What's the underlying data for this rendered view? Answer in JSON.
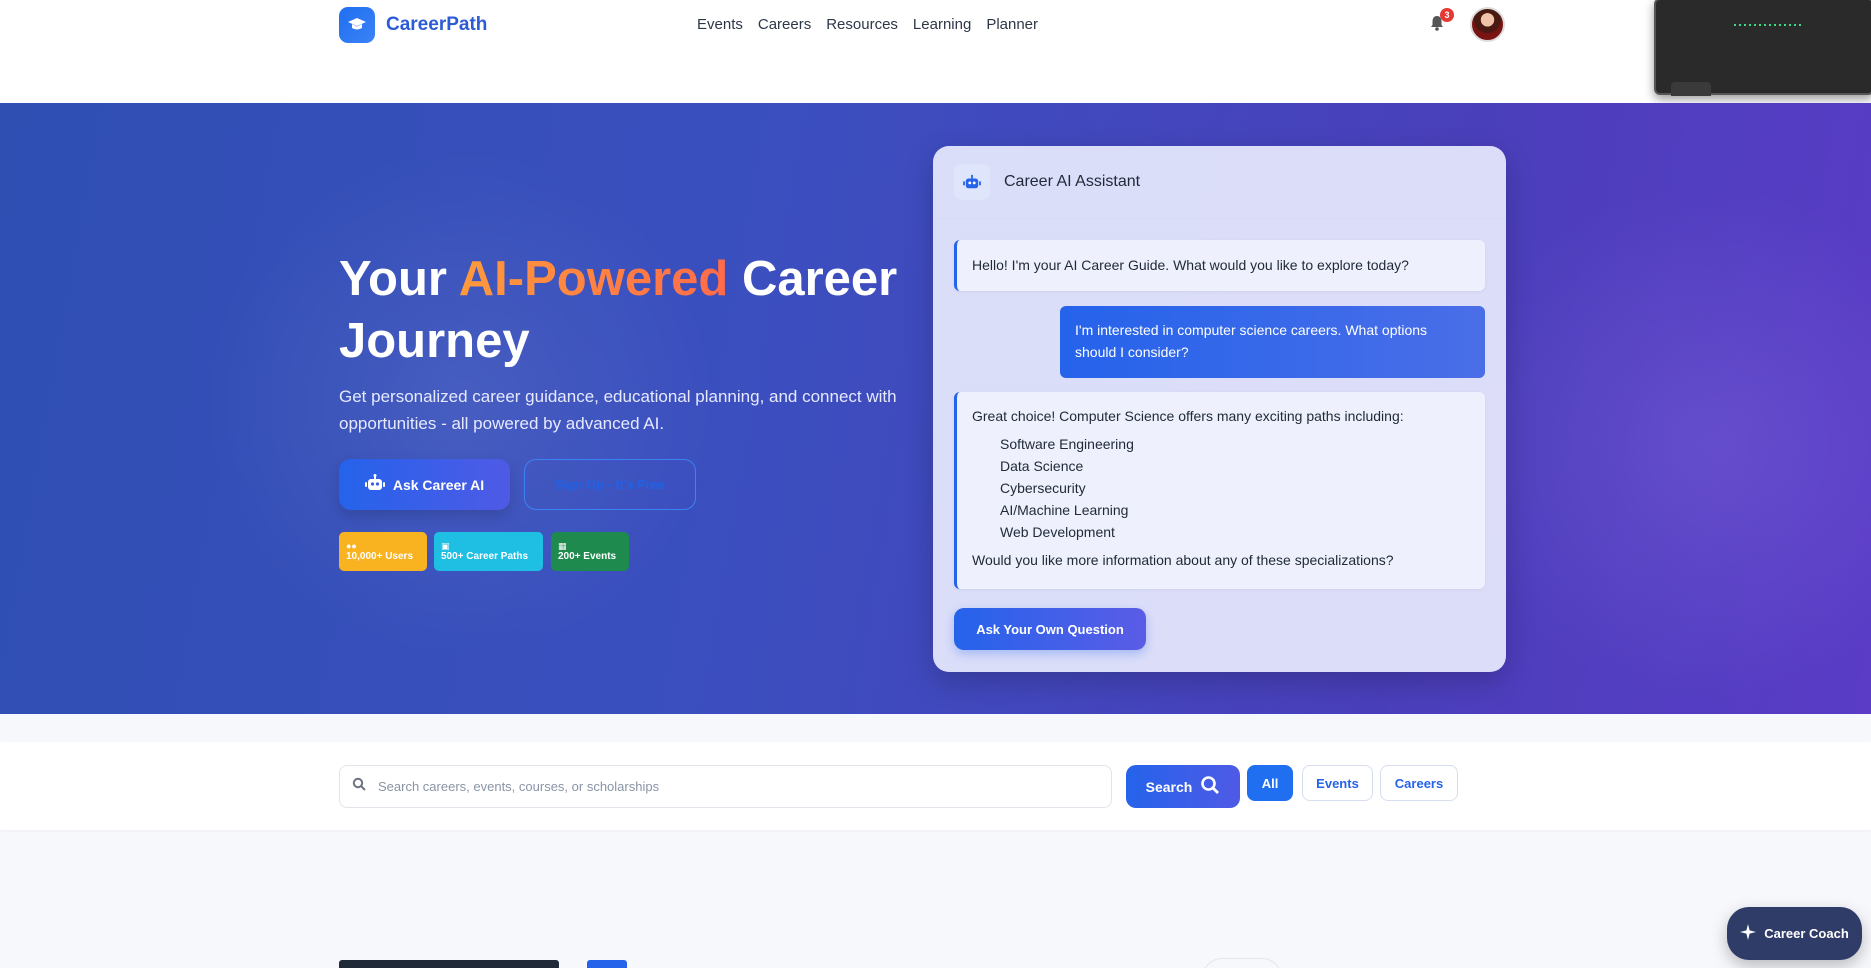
{
  "brand": {
    "name": "CareerPath",
    "icon": "graduation-cap-icon"
  },
  "nav": {
    "links": [
      "Events",
      "Careers",
      "Resources",
      "Learning",
      "Planner"
    ]
  },
  "notifications": {
    "count": "3",
    "icon": "bell-icon"
  },
  "hero": {
    "title_part1": "Your ",
    "title_accent": "AI-Powered",
    "title_part2": " Career Journey",
    "subtitle": "Get personalized career guidance, educational planning, and connect with opportunities - all powered by advanced AI.",
    "ask_button": "Ask Career AI",
    "signup_button": "Sign Up - It's Free",
    "stats": [
      {
        "label": "10,000+ Users",
        "icon": "users-icon"
      },
      {
        "label": "500+ Career Paths",
        "icon": "briefcase-icon"
      },
      {
        "label": "200+ Events",
        "icon": "calendar-icon"
      }
    ]
  },
  "chat": {
    "title": "Career AI Assistant",
    "icon": "robot-icon",
    "greeting": "Hello! I'm your AI Career Guide. What would you like to explore today?",
    "user_message": "I'm interested in computer science careers. What options should I consider?",
    "reply_intro": "Great choice! Computer Science offers many exciting paths including:",
    "reply_items": [
      "Software Engineering",
      "Data Science",
      "Cybersecurity",
      "AI/Machine Learning",
      "Web Development"
    ],
    "reply_outro": "Would you like more information about any of these specializations?",
    "ask_own_button": "Ask Your Own Question"
  },
  "search": {
    "placeholder": "Search careers, events, courses, or scholarships",
    "button": "Search",
    "filters": [
      "All",
      "Events",
      "Careers"
    ],
    "active_filter": "All"
  },
  "coach": {
    "label": "Career Coach",
    "icon": "sparkle-icon"
  },
  "colors": {
    "primary": "#2563eb",
    "accent": "#ff7a45",
    "hero_start": "#2f4fb3",
    "hero_end": "#5a3cc6"
  }
}
